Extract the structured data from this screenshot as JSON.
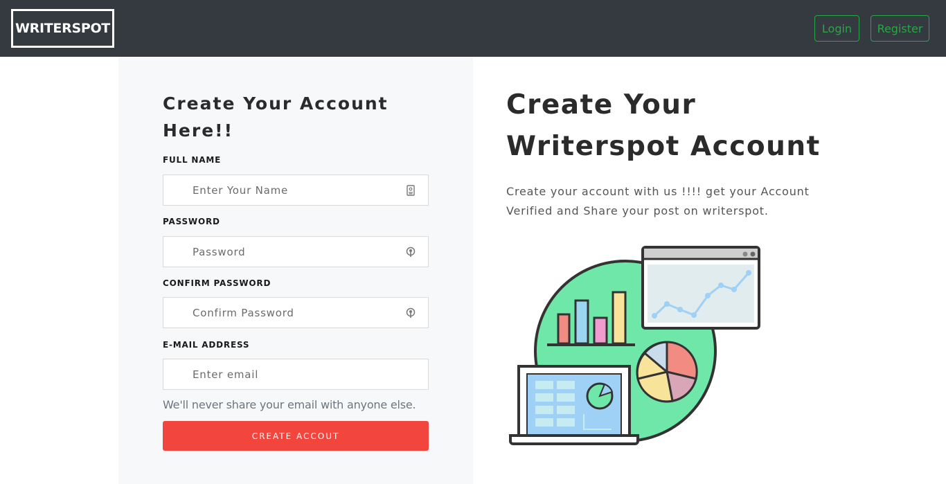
{
  "navbar": {
    "brand": "WRITERSPOT",
    "login_label": "Login",
    "register_label": "Register",
    "accent_color": "#28a745",
    "background_color": "#343a40"
  },
  "form": {
    "title": "Create Your Account Here!!",
    "fields": [
      {
        "label": "FULL NAME",
        "placeholder": "Enter Your Name",
        "icon": "id-card-icon"
      },
      {
        "label": "PASSWORD",
        "placeholder": "Password",
        "icon": "key-icon"
      },
      {
        "label": "CONFIRM PASSWORD",
        "placeholder": "Confirm Password",
        "icon": "key-icon"
      },
      {
        "label": "E-MAIL ADDRESS",
        "placeholder": "Enter email",
        "icon": ""
      }
    ],
    "help_text": "We'll never share your email with anyone else.",
    "submit_label": "CREATE ACCOUT",
    "submit_color": "#f1453d"
  },
  "info": {
    "title": "Create Your Writerspot Account",
    "description": "Create your account with us !!!! get your Account Verified and Share your post on writerspot.",
    "illustration": "analytics-dashboard-illustration"
  }
}
